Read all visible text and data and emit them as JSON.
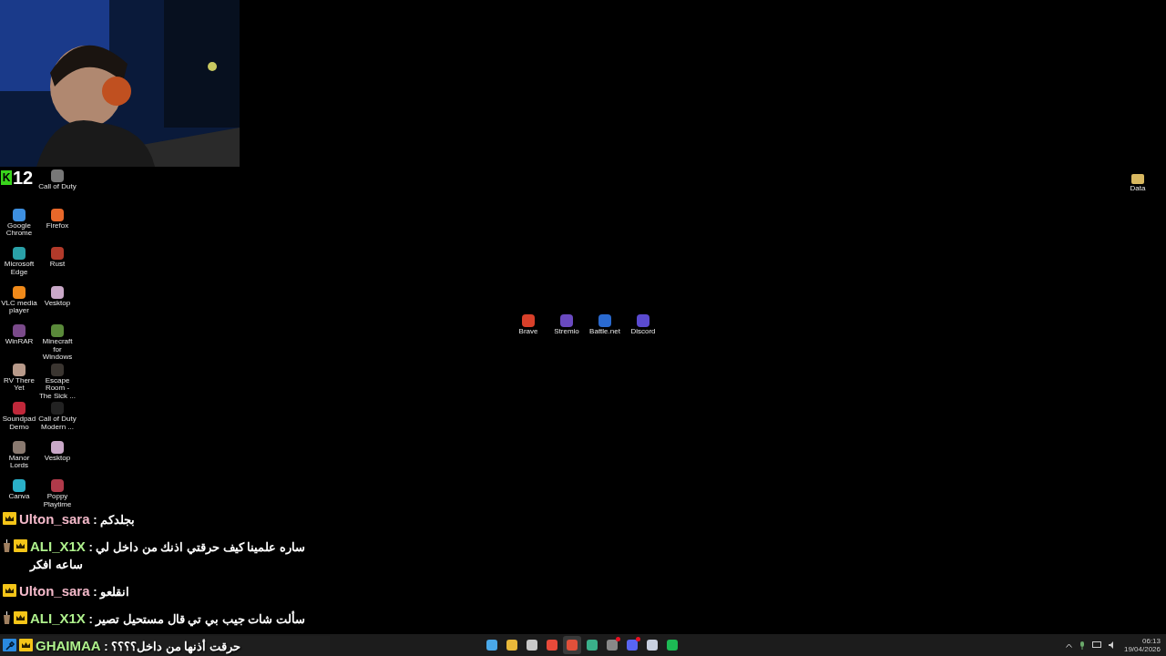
{
  "overlay": {
    "logo_letter": "K",
    "counter": "12"
  },
  "desktop_icons": [
    {
      "label": "Call of Duty",
      "color": "#777777"
    },
    {
      "label": "Google Chrome",
      "color": "#3d8fe0"
    },
    {
      "label": "Firefox",
      "color": "#e8682a"
    },
    {
      "label": "Microsoft Edge",
      "color": "#2aa1a8"
    },
    {
      "label": "Rust",
      "color": "#b23a2a"
    },
    {
      "label": "VLC media player",
      "color": "#f08a1a"
    },
    {
      "label": "Vesktop",
      "color": "#c9a8c8"
    },
    {
      "label": "WinRAR",
      "color": "#7a4a8a"
    },
    {
      "label": "Minecraft for Windows",
      "color": "#5a8a3a"
    },
    {
      "label": "RV There Yet",
      "color": "#b89a8a"
    },
    {
      "label": "Escape Room - The Sick ...",
      "color": "#3a3530"
    },
    {
      "label": "Soundpad Demo",
      "color": "#c0283a"
    },
    {
      "label": "Call of Duty Modern ...",
      "color": "#222222"
    },
    {
      "label": "Manor Lords",
      "color": "#8a7a70"
    },
    {
      "label": "Vesktop",
      "color": "#c9a8c8"
    },
    {
      "label": "Canva",
      "color": "#2ab0c8"
    },
    {
      "label": "Poppy Playtime",
      "color": "#b03a4a"
    }
  ],
  "center_icons": [
    {
      "label": "Brave",
      "color": "#d8402a"
    },
    {
      "label": "Stremio",
      "color": "#6a4ac0"
    },
    {
      "label": "Battle.net",
      "color": "#2a6ad0"
    },
    {
      "label": "Discord",
      "color": "#5a4ad0"
    }
  ],
  "corner_icon": {
    "label": "Data"
  },
  "chat": [
    {
      "badges": [
        {
          "kind": "crown"
        }
      ],
      "user": "Ulton_sara",
      "color": "#f3b9c9",
      "separator": ":",
      "message": "بجلدكم"
    },
    {
      "badges": [
        {
          "kind": "cup"
        },
        {
          "kind": "crown"
        }
      ],
      "user": "ALI_X1X",
      "color": "#aef08c",
      "separator": ":",
      "message": "ساره علمينا كيف حرقتي اذنك من داخل لي ساعه افكر"
    },
    {
      "badges": [
        {
          "kind": "crown"
        }
      ],
      "user": "Ulton_sara",
      "color": "#f3b9c9",
      "separator": ":",
      "message": "انقلعو"
    },
    {
      "badges": [
        {
          "kind": "cup"
        },
        {
          "kind": "crown"
        }
      ],
      "user": "ALI_X1X",
      "color": "#aef08c",
      "separator": ":",
      "message": "سألت شات جيب بي تي قال مستحيل تصير"
    },
    {
      "badges": [
        {
          "kind": "hammer"
        },
        {
          "kind": "crown"
        }
      ],
      "user": "GHAIMAA",
      "color": "#aef08c",
      "separator": ":",
      "message": "حرقت أذنها من داخل؟؟؟؟"
    }
  ],
  "taskbar": {
    "apps": [
      {
        "color": "#4aa8e8",
        "selected": false,
        "badge": false
      },
      {
        "color": "#e8b83a",
        "selected": false,
        "badge": false
      },
      {
        "color": "#c8c8c8",
        "selected": false,
        "badge": false
      },
      {
        "color": "#e84a3a",
        "selected": false,
        "badge": false
      },
      {
        "color": "#e0503a",
        "selected": true,
        "badge": false
      },
      {
        "color": "#3ab08a",
        "selected": false,
        "badge": false
      },
      {
        "color": "#888888",
        "selected": false,
        "badge": true
      },
      {
        "color": "#5865f2",
        "selected": false,
        "badge": true
      },
      {
        "color": "#c8d0e0",
        "selected": false,
        "badge": false
      },
      {
        "color": "#1db954",
        "selected": false,
        "badge": false
      }
    ],
    "time": "06:13",
    "date": "19/04/2026"
  }
}
